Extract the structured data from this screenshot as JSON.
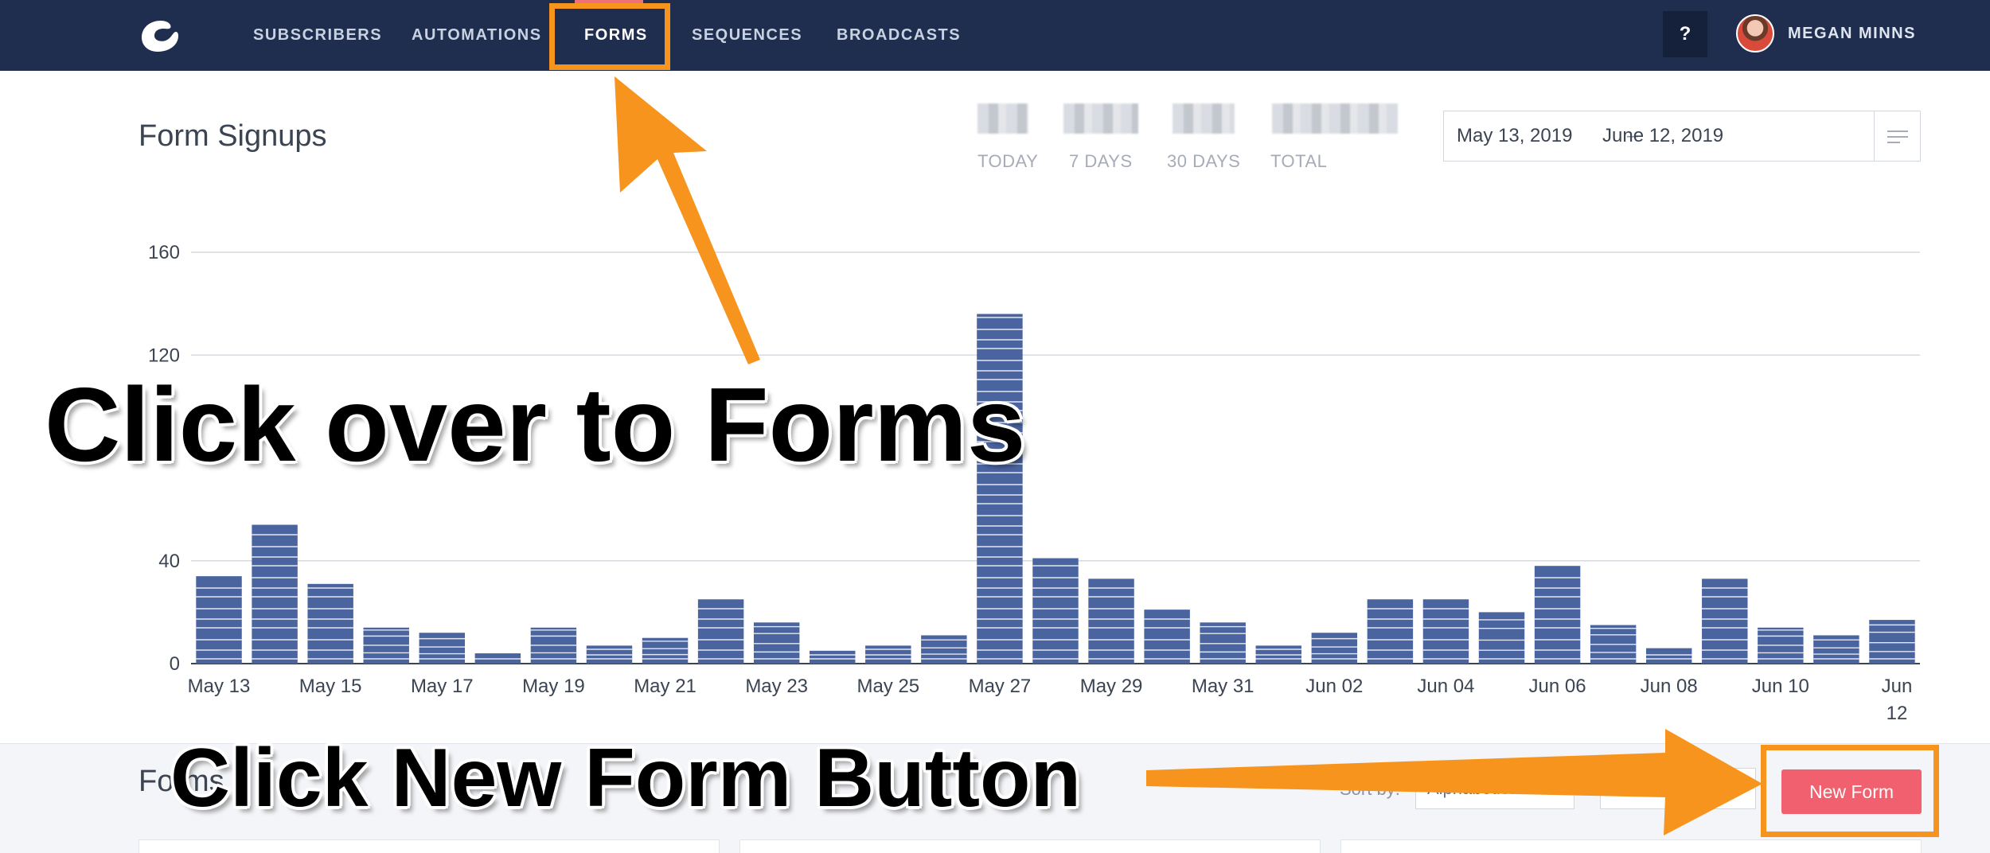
{
  "nav": {
    "items": [
      "SUBSCRIBERS",
      "AUTOMATIONS",
      "FORMS",
      "SEQUENCES",
      "BROADCASTS"
    ],
    "active": "FORMS",
    "help_label": "?",
    "user_name": "MEGAN MINNS",
    "logo_icon": "convertkit-logo-icon",
    "accent_color": "#f0707a",
    "bar_color": "#1f2d4f"
  },
  "header": {
    "title": "Form Signups",
    "stats": [
      {
        "label": "TODAY"
      },
      {
        "label": "7 DAYS"
      },
      {
        "label": "30 DAYS"
      },
      {
        "label": "TOTAL"
      }
    ],
    "date_range": {
      "start": "May 13, 2019",
      "separator": "–",
      "end": "June 12, 2019",
      "menu_icon": "menu-lines-icon"
    }
  },
  "chart_data": {
    "type": "bar",
    "stacked": true,
    "bar_color": "#4a64a0",
    "categories": [
      "May 13",
      "May 14",
      "May 15",
      "May 16",
      "May 17",
      "May 18",
      "May 19",
      "May 20",
      "May 21",
      "May 22",
      "May 23",
      "May 24",
      "May 25",
      "May 26",
      "May 27",
      "May 28",
      "May 29",
      "May 30",
      "May 31",
      "Jun 01",
      "Jun 02",
      "Jun 03",
      "Jun 04",
      "Jun 05",
      "Jun 06",
      "Jun 07",
      "Jun 08",
      "Jun 09",
      "Jun 10",
      "Jun 11",
      "Jun 12"
    ],
    "values": [
      34,
      54,
      31,
      14,
      12,
      4,
      14,
      7,
      10,
      25,
      16,
      5,
      7,
      11,
      136,
      41,
      33,
      21,
      16,
      7,
      12,
      25,
      25,
      20,
      38,
      15,
      6,
      33,
      14,
      11,
      17
    ],
    "tick_labels": [
      "May 13",
      "May 15",
      "May 17",
      "May 19",
      "May 21",
      "May 23",
      "May 25",
      "May 27",
      "May 29",
      "May 31",
      "Jun 02",
      "Jun 04",
      "Jun 06",
      "Jun 08",
      "Jun 10",
      "Jun 12"
    ],
    "y_ticks": [
      0,
      40,
      120,
      160
    ],
    "ylim": [
      0,
      160
    ],
    "grid": true,
    "title": "",
    "xlabel": "",
    "ylabel": ""
  },
  "forms": {
    "heading": "Forms",
    "sort_label": "Sort by:",
    "sort_value": "Alphabetical",
    "new_form_label": "New Form",
    "button_color": "#f0606e"
  },
  "annotations": {
    "callout_forms": "Click over to Forms",
    "callout_new_form": "Click New Form Button",
    "highlight_color": "#f7941d"
  }
}
